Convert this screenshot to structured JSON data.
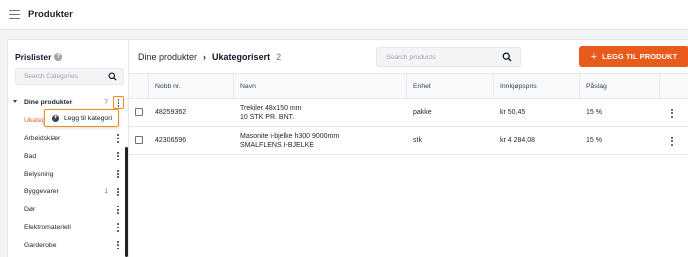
{
  "app": {
    "title": "Produkter"
  },
  "sidebar": {
    "title": "Prislister",
    "search_placeholder": "Search Categories",
    "root": {
      "label": "Dine produkter",
      "count": "7"
    },
    "items": [
      {
        "label": "Ukategorisert",
        "count": "",
        "active": true
      },
      {
        "label": "Arbeidsklær",
        "count": ""
      },
      {
        "label": "Bad",
        "count": ""
      },
      {
        "label": "Belysning",
        "count": ""
      },
      {
        "label": "Byggevarer",
        "count": "1"
      },
      {
        "label": "Dør",
        "count": ""
      },
      {
        "label": "Elektromateriell",
        "count": ""
      },
      {
        "label": "Garderobe",
        "count": ""
      }
    ],
    "context_menu": {
      "label": "Legg til kategori"
    },
    "active_color": "#f05a1a",
    "highlight_color": "#f0901a"
  },
  "main": {
    "breadcrumb": {
      "root": "Dine produkter",
      "current": "Ukategorisert",
      "count": "2"
    },
    "search_placeholder": "Search products",
    "add_button_label": "LEGG TIL PRODUKT",
    "add_button_color": "#e85b1a",
    "columns": [
      "Nobb nr.",
      "Navn",
      "Enhet",
      "Innkjøpspris",
      "Påslag"
    ],
    "rows": [
      {
        "nobb": "48259362",
        "name_line1": "Trekiler 48x150 mm",
        "name_line2": "10 STK PR. BNT.",
        "unit": "pakke",
        "price": "kr 50,45",
        "markup": "15 %"
      },
      {
        "nobb": "42306596",
        "name_line1": "Masonite i-bjelke h300 9000mm",
        "name_line2": "SMALFLENS I-BJELKE",
        "unit": "stk",
        "price": "kr 4 284,08",
        "markup": "15 %"
      }
    ]
  }
}
